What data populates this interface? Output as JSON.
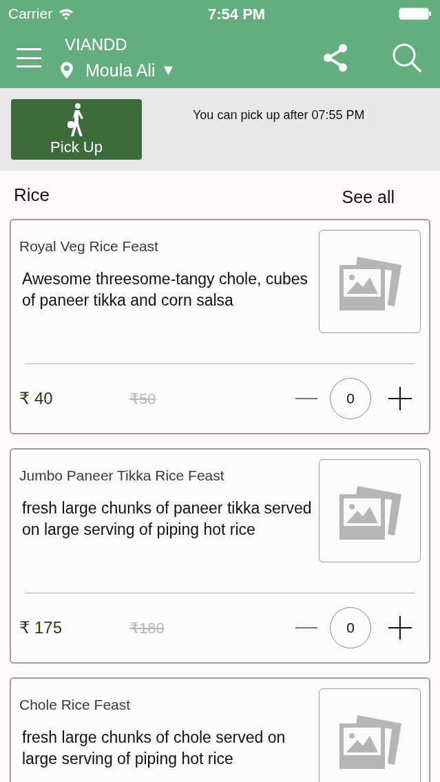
{
  "status_bar": {
    "carrier": "Carrier",
    "time": "7:54 PM"
  },
  "nav": {
    "title": "VIANDD",
    "location": "Moula Ali",
    "location_caret": "▼"
  },
  "pickup": {
    "button": "Pick Up",
    "note": "You can pick up after 07:55 PM"
  },
  "section": {
    "title": "Rice",
    "see_all": "See all"
  },
  "items": [
    {
      "name": "Royal Veg Rice Feast",
      "description": "Awesome threesome-tangy chole, cubes of paneer tikka and corn salsa",
      "price": "₹ 40",
      "old_price": "₹50",
      "quantity": "0"
    },
    {
      "name": "Jumbo Paneer Tikka Rice Feast",
      "description": "fresh large chunks of paneer tikka served on large serving of piping hot rice",
      "price": "₹ 175",
      "old_price": "₹180",
      "quantity": "0"
    },
    {
      "name": "Chole Rice Feast",
      "description": "fresh large chunks of chole served on large serving of piping hot rice"
    }
  ]
}
